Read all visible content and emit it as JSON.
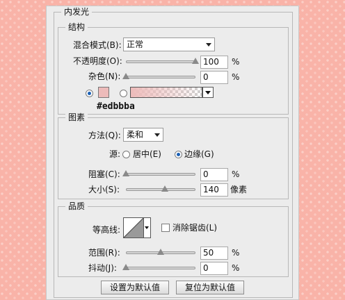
{
  "dialog": {
    "title": "内发光"
  },
  "structure": {
    "title": "结构",
    "blend_mode_label": "混合模式(B):",
    "blend_mode_value": "正常",
    "opacity_label": "不透明度(O):",
    "opacity_value": "100",
    "opacity_unit": "%",
    "opacity_level": 1.0,
    "noise_label": "杂色(N):",
    "noise_value": "0",
    "noise_unit": "%",
    "noise_level": 0.0,
    "color_mode": "solid",
    "swatch_color": "#edbbba",
    "color_annotation": "#edbbba"
  },
  "elements": {
    "title": "图素",
    "technique_label": "方法(Q):",
    "technique_value": "柔和",
    "source_label": "源:",
    "source_center_label": "居中(E)",
    "source_edge_label": "边缘(G)",
    "source_selected": "edge",
    "choke_label": "阻塞(C):",
    "choke_value": "0",
    "choke_unit": "%",
    "choke_level": 0.0,
    "size_label": "大小(S):",
    "size_value": "140",
    "size_unit": "像素",
    "size_level": 0.56
  },
  "quality": {
    "title": "品质",
    "contour_label": "等高线:",
    "antialias_label": "消除锯齿(L)",
    "antialias_checked": false,
    "range_label": "范围(R):",
    "range_value": "50",
    "range_unit": "%",
    "range_level": 0.5,
    "jitter_label": "抖动(J):",
    "jitter_value": "0",
    "jitter_unit": "%",
    "jitter_level": 0.0
  },
  "buttons": {
    "set_default": "设置为默认值",
    "reset_default": "复位为默认值"
  }
}
